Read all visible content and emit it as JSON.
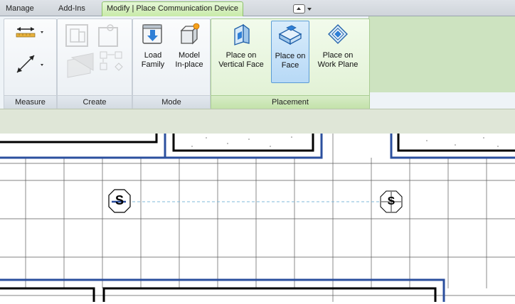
{
  "tabs": [
    {
      "label": "Manage",
      "active": false
    },
    {
      "label": "Add-Ins",
      "active": false
    },
    {
      "label": "Modify | Place Communication Device",
      "active": true
    }
  ],
  "quick_access": {
    "icon": "switch-windows-icon"
  },
  "panels": {
    "measure": {
      "title": "Measure"
    },
    "create": {
      "title": "Create"
    },
    "mode": {
      "title": "Mode",
      "load_family": "Load\nFamily",
      "model_inplace": "Model\nIn-place"
    },
    "placement": {
      "title": "Placement",
      "vertical_face": "Place on\nVertical Face",
      "face": "Place on\nFace",
      "work_plane": "Place on\nWork Plane",
      "selected": "face"
    }
  },
  "canvas": {
    "placed_device_symbol": "S",
    "preview_device_symbol": "S"
  },
  "colors": {
    "wall_blue": "#2b4f9e",
    "ribbon_green": "#cde3c0",
    "selection_blue": "#5a9bd5"
  }
}
